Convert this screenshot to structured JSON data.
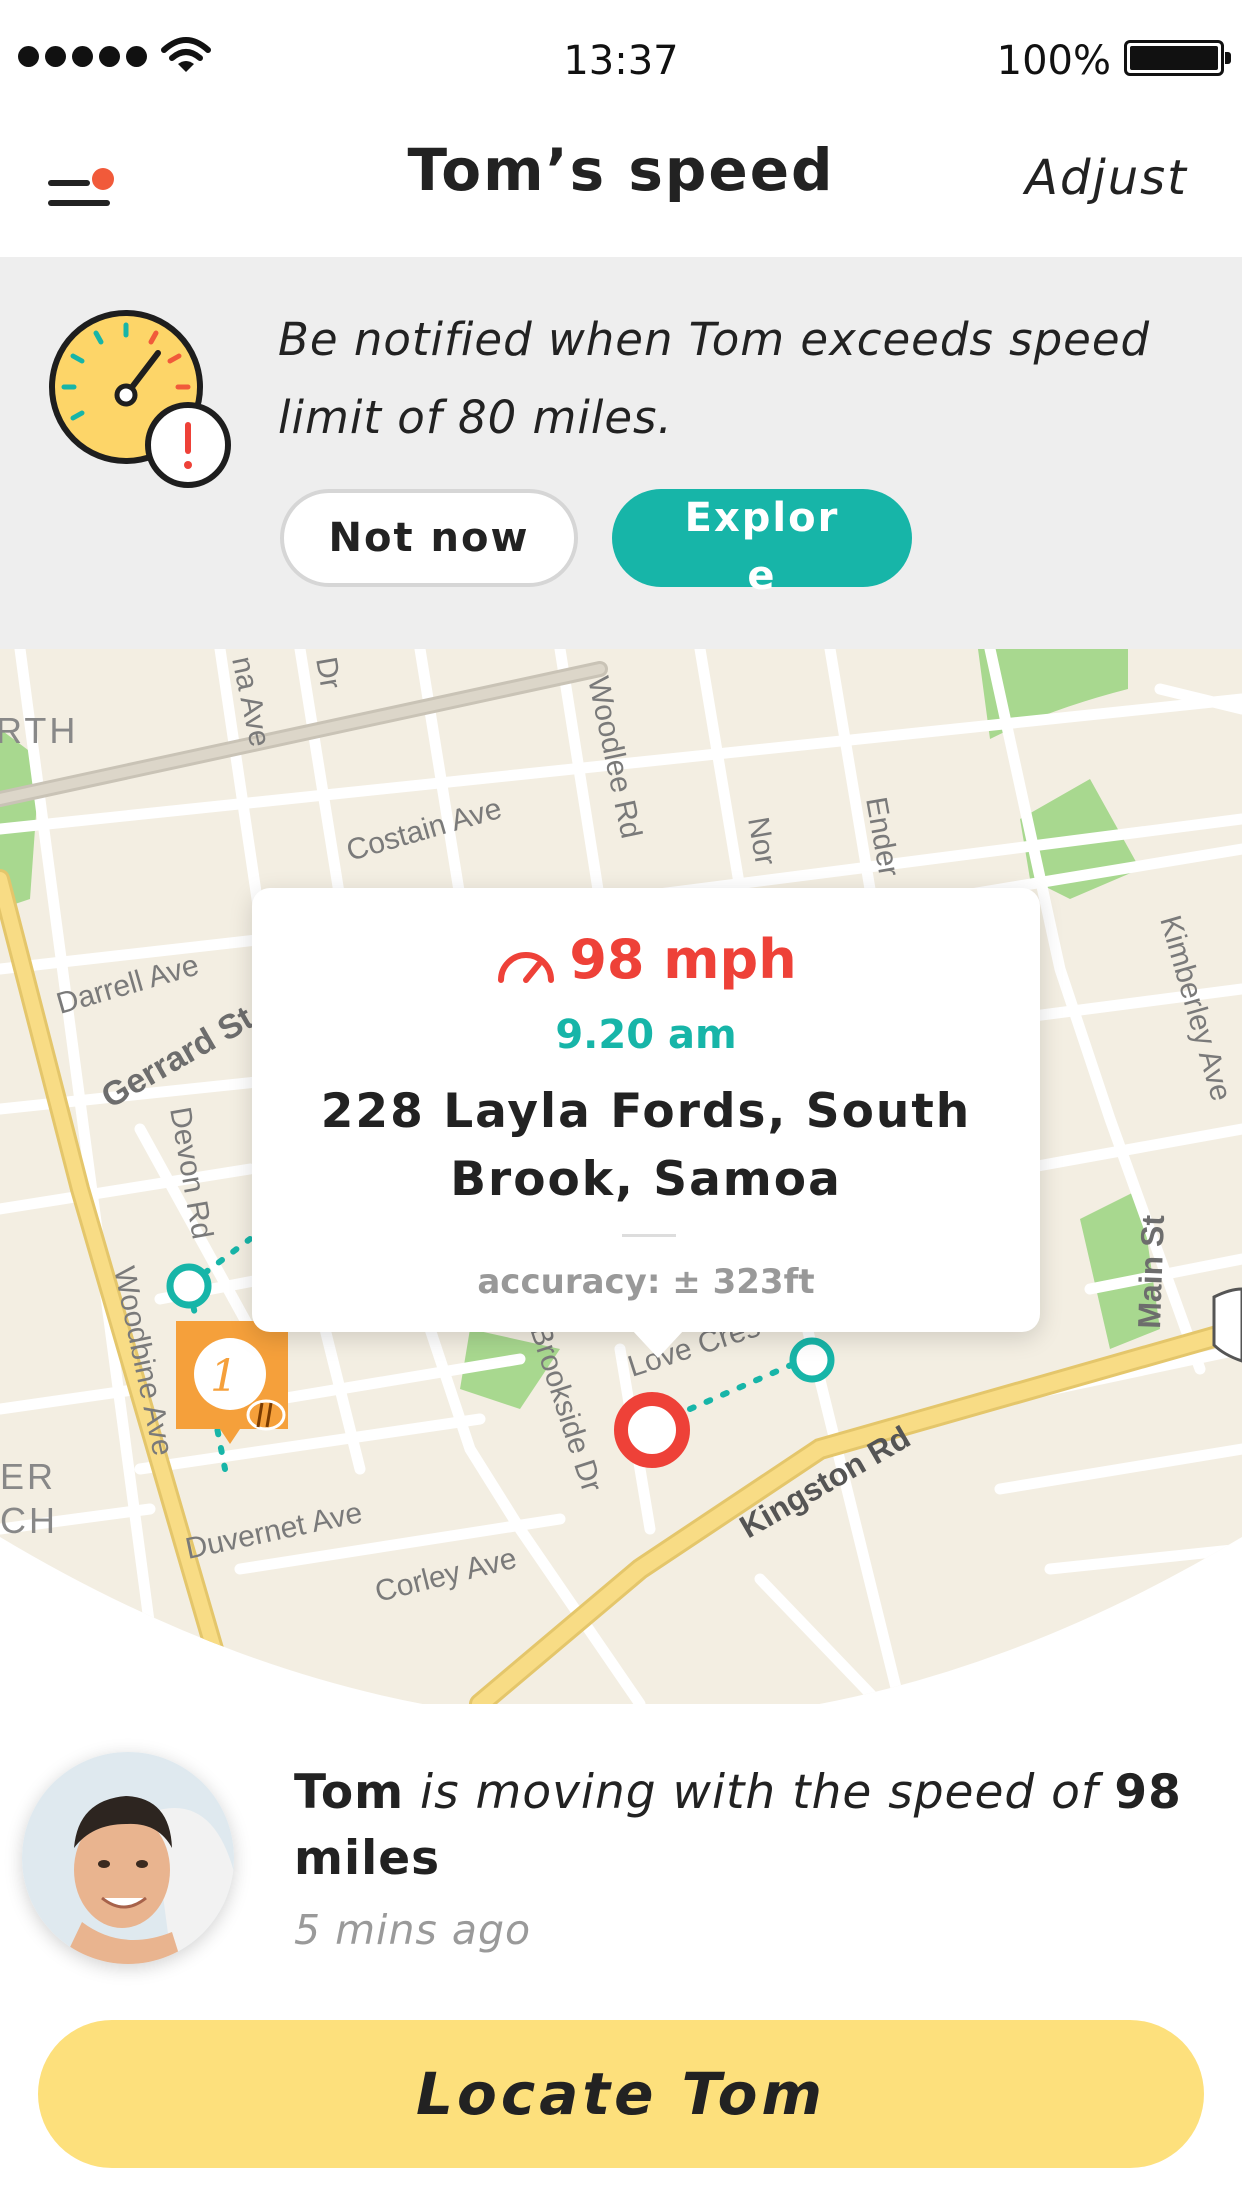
{
  "status_bar": {
    "time": "13:37",
    "battery_text": "100%",
    "signal_icon": "signal-dots-icon",
    "wifi_icon": "wifi-icon",
    "battery_icon": "battery-icon",
    "battery_level": 1.0
  },
  "nav": {
    "title": "Tom’s speed",
    "adjust_label": "Adjust",
    "menu_icon": "hamburger-menu-icon"
  },
  "banner": {
    "text": "Be notified when Tom exceeds speed limit of 80 miles.",
    "not_now_label": "Not now",
    "explore_label": "Explore",
    "icon": "speedometer-alert-icon"
  },
  "map": {
    "street_labels": {
      "costain": "Costain Ave",
      "darrell": "Darrell Ave",
      "gerrard": "Gerrard St",
      "devon": "Devon Rd",
      "woodlee": "Woodlee Rd",
      "nor": "Nor",
      "ender": "Ender",
      "kimberley": "Kimberley Ave",
      "main": "Main St",
      "woodbine": "Woodbine Ave",
      "duvernet": "Duvernet Ave",
      "corley": "Corley Ave",
      "brookside": "Brookside Dr",
      "kingston": "Kingston Rd",
      "love": "Love Cres",
      "na": "na Ave",
      "dr": "Dr",
      "rth": "RTH",
      "er": "ER",
      "ch": "CH"
    },
    "cluster_count": "1",
    "colors": {
      "accent": "#17b5a8",
      "alert": "#ee4138",
      "cluster": "#f5a03b",
      "map_bg": "#f3eee2",
      "road_major": "#f8dc85",
      "park": "#a8d88f"
    }
  },
  "popup": {
    "speed": "98 mph",
    "time": "9.20 am",
    "address": "228 Layla Fords, South Brook, Samoa",
    "accuracy": "accuracy: ± 323ft"
  },
  "status": {
    "name": "Tom",
    "middle": "is moving with the speed of",
    "speed_value": "98",
    "unit": "miles",
    "time_ago": "5 mins ago"
  },
  "locate_button_label": "Locate Tom"
}
